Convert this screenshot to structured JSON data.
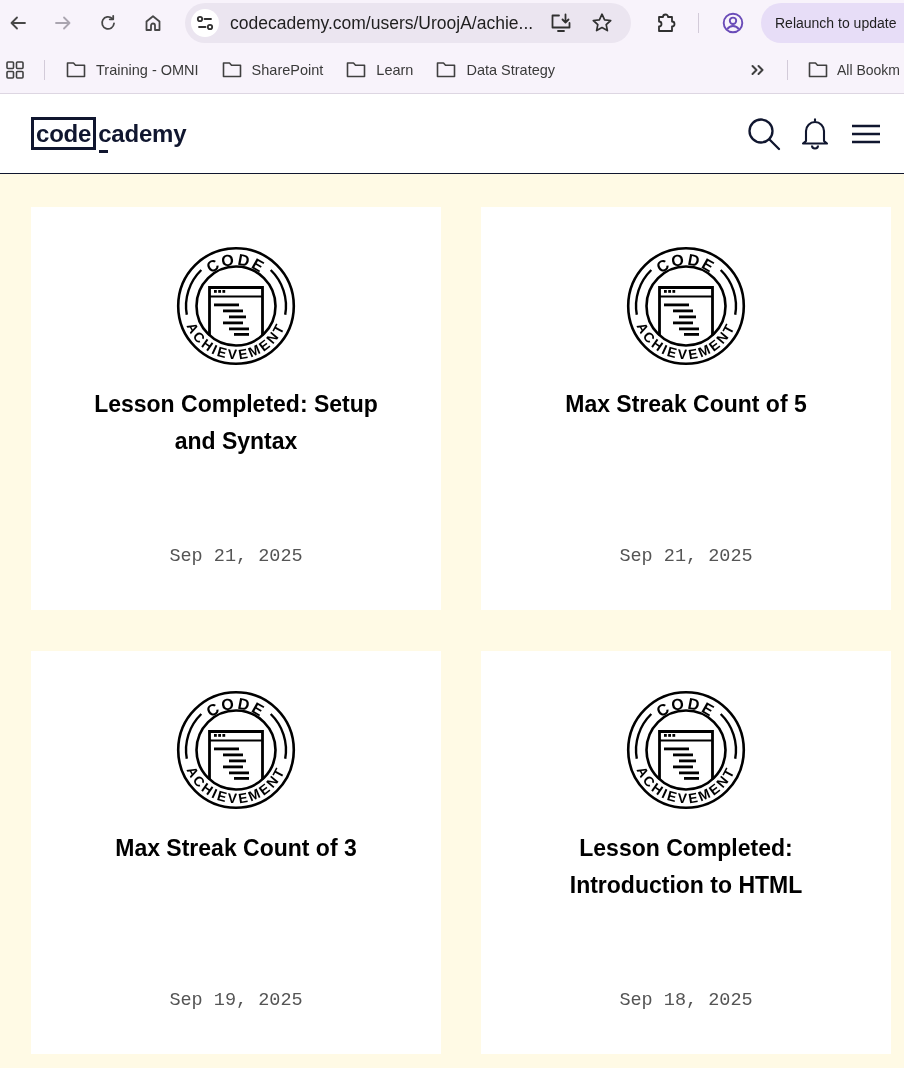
{
  "browser": {
    "nav_buttons": [
      {
        "kind": "back",
        "disabled": false
      },
      {
        "kind": "forward",
        "disabled": true
      },
      {
        "kind": "reload",
        "disabled": false
      },
      {
        "kind": "home",
        "disabled": false
      }
    ],
    "address_bar": {
      "url": "codecademy.com/users/UroojA/achie..."
    },
    "relaunch_button": {
      "label": "Relaunch to update"
    }
  },
  "bookmarks_bar": {
    "items": [
      "Training - OMNI",
      "SharePoint",
      "Learn",
      "Data Strategy"
    ],
    "overflow_items": [
      "All Bookm"
    ]
  },
  "site_header": {
    "logo": {
      "boxed": "code",
      "rest": "cademy"
    }
  },
  "achievements": [
    {
      "badge": {
        "top": "CODE",
        "bottom": "ACHIEVEMENT"
      },
      "title": "Lesson Completed: Setup and Syntax",
      "date": "Sep 21, 2025"
    },
    {
      "badge": {
        "top": "CODE",
        "bottom": "ACHIEVEMENT"
      },
      "title": "Max Streak Count of 5",
      "date": "Sep 21, 2025"
    },
    {
      "badge": {
        "top": "CODE",
        "bottom": "ACHIEVEMENT"
      },
      "title": "Max Streak Count of 3",
      "date": "Sep 19, 2025"
    },
    {
      "badge": {
        "top": "CODE",
        "bottom": "ACHIEVEMENT"
      },
      "title": "Lesson Completed: Introduction to HTML",
      "date": "Sep 18, 2025"
    }
  ]
}
